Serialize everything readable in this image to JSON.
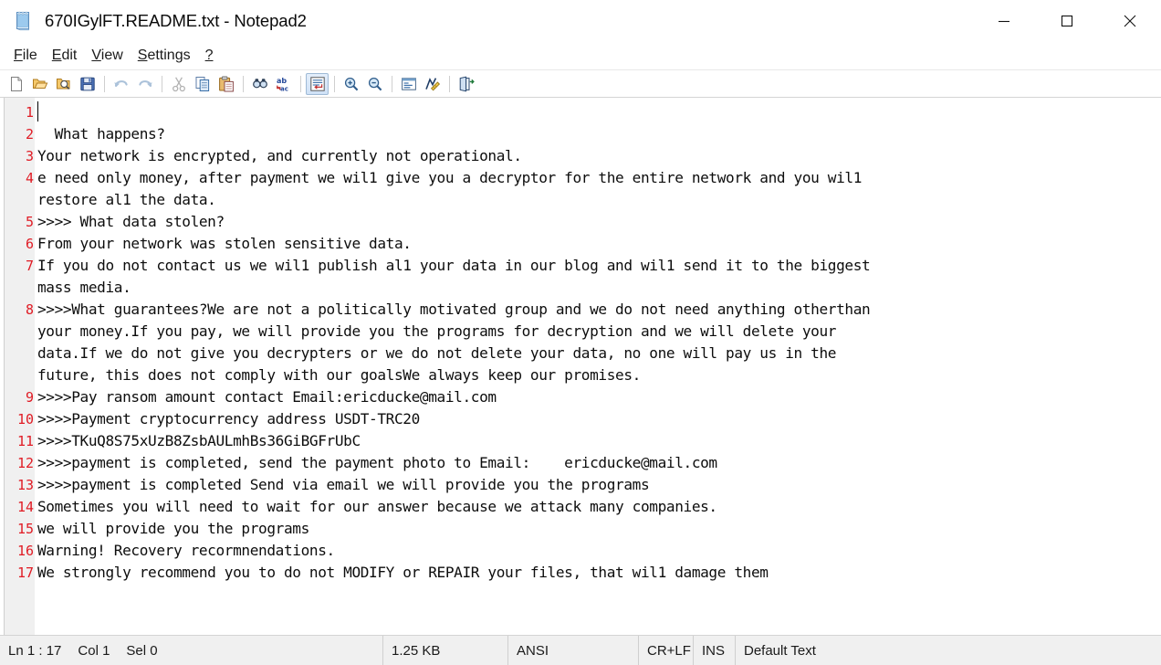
{
  "window": {
    "title": "670IGylFT.README.txt - Notepad2",
    "icon": "notepad-document-icon",
    "controls": {
      "minimize": "minimize-icon",
      "maximize": "maximize-icon",
      "close": "close-icon"
    }
  },
  "menubar": {
    "items": [
      {
        "label": "File",
        "accel": "F"
      },
      {
        "label": "Edit",
        "accel": "E"
      },
      {
        "label": "View",
        "accel": "V"
      },
      {
        "label": "Settings",
        "accel": "S"
      },
      {
        "label": "?",
        "accel": "?"
      }
    ]
  },
  "toolbar": {
    "buttons": [
      {
        "name": "new-file-icon",
        "sep_after": false,
        "state": "enabled"
      },
      {
        "name": "open-file-icon",
        "sep_after": false,
        "state": "enabled"
      },
      {
        "name": "browse-file-icon",
        "sep_after": false,
        "state": "enabled"
      },
      {
        "name": "save-file-icon",
        "sep_after": true,
        "state": "enabled"
      },
      {
        "name": "undo-icon",
        "sep_after": false,
        "state": "disabled"
      },
      {
        "name": "redo-icon",
        "sep_after": true,
        "state": "disabled"
      },
      {
        "name": "cut-icon",
        "sep_after": false,
        "state": "disabled"
      },
      {
        "name": "copy-icon",
        "sep_after": false,
        "state": "enabled"
      },
      {
        "name": "paste-icon",
        "sep_after": true,
        "state": "enabled"
      },
      {
        "name": "find-icon",
        "sep_after": false,
        "state": "enabled"
      },
      {
        "name": "replace-icon",
        "sep_after": true,
        "state": "enabled"
      },
      {
        "name": "word-wrap-icon",
        "sep_after": true,
        "state": "active"
      },
      {
        "name": "zoom-in-icon",
        "sep_after": false,
        "state": "enabled"
      },
      {
        "name": "zoom-out-icon",
        "sep_after": true,
        "state": "enabled"
      },
      {
        "name": "scheme-icon",
        "sep_after": false,
        "state": "enabled"
      },
      {
        "name": "customize-scheme-icon",
        "sep_after": true,
        "state": "enabled"
      },
      {
        "name": "exit-icon",
        "sep_after": false,
        "state": "enabled"
      }
    ]
  },
  "editor": {
    "lines": [
      {
        "number": "1",
        "rows": [
          ""
        ]
      },
      {
        "number": "2",
        "rows": [
          "  What happens?"
        ]
      },
      {
        "number": "3",
        "rows": [
          "Your network is encrypted, and currently not operational."
        ]
      },
      {
        "number": "4",
        "rows": [
          "e need only money, after payment we wil1 give you a decryptor for the entire network and you wil1",
          "restore al1 the data."
        ]
      },
      {
        "number": "5",
        "rows": [
          ">>>> What data stolen?"
        ]
      },
      {
        "number": "6",
        "rows": [
          "From your network was stolen sensitive data."
        ]
      },
      {
        "number": "7",
        "rows": [
          "If you do not contact us we wil1 publish al1 your data in our blog and wil1 send it to the biggest",
          "mass media."
        ]
      },
      {
        "number": "8",
        "rows": [
          ">>>>What guarantees?We are not a politically motivated group and we do not need anything otherthan",
          "your money.If you pay, we will provide you the programs for decryption and we will delete your",
          "data.If we do not give you decrypters or we do not delete your data, no one will pay us in the",
          "future, this does not comply with our goalsWe always keep our promises."
        ]
      },
      {
        "number": "9",
        "rows": [
          ">>>>Pay ransom amount contact Email:ericducke@mail.com"
        ]
      },
      {
        "number": "10",
        "rows": [
          ">>>>Payment cryptocurrency address USDT-TRC20"
        ]
      },
      {
        "number": "11",
        "rows": [
          ">>>>TKuQ8S75xUzB8ZsbAULmhBs36GiBGFrUbC"
        ]
      },
      {
        "number": "12",
        "rows": [
          ">>>>payment is completed, send the payment photo to Email:    ericducke@mail.com"
        ]
      },
      {
        "number": "13",
        "rows": [
          ">>>>payment is completed Send via email we will provide you the programs"
        ]
      },
      {
        "number": "14",
        "rows": [
          "Sometimes you will need to wait for our answer because we attack many companies."
        ]
      },
      {
        "number": "15",
        "rows": [
          "we will provide you the programs"
        ]
      },
      {
        "number": "16",
        "rows": [
          "Warning! Recovery recormnendations."
        ]
      },
      {
        "number": "17",
        "rows": [
          "We strongly recommend you to do not MODIFY or REPAIR your files, that wil1 damage them"
        ]
      }
    ],
    "line_number_color": "#e01b24",
    "gutter_background": "#f0f0f0",
    "text_color": "#0d0d0d"
  },
  "statusbar": {
    "line_position": "Ln 1 : 17",
    "column": "Col 1",
    "selection": "Sel 0",
    "file_size": "1.25 KB",
    "encoding": "ANSI",
    "line_endings": "CR+LF",
    "insert_mode": "INS",
    "scheme": "Default Text"
  }
}
